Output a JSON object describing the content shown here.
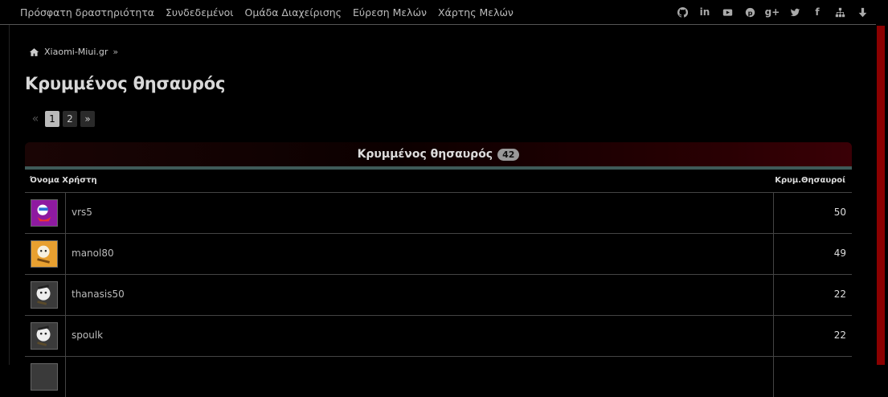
{
  "nav": {
    "links": [
      "Πρόσφατη δραστηριότητα",
      "Συνδεδεμένοι",
      "Ομάδα Διαχείρισης",
      "Εύρεση Μελών",
      "Χάρτης Μελών"
    ],
    "social_icons": [
      "github-icon",
      "linkedin-icon",
      "youtube-icon",
      "pinterest-icon",
      "google-plus-icon",
      "twitter-icon",
      "facebook-icon",
      "sitemap-icon",
      "arrow-down-icon"
    ]
  },
  "breadcrumb": {
    "home": "Xiaomi-Miui.gr",
    "separator": "»"
  },
  "page": {
    "title": "Κρυμμένος θησαυρός"
  },
  "pager": {
    "prev": "«",
    "pages": [
      "1",
      "2"
    ],
    "active": "1",
    "next": "»"
  },
  "block": {
    "title": "Κρυμμένος θησαυρός",
    "count": "42"
  },
  "table": {
    "col_user": "Όνομα Χρήστη",
    "col_value": "Κρυμ.Θησαυροί",
    "rows": [
      {
        "name": "vrs5",
        "value": "50",
        "avatar_color": "#8e1aa0"
      },
      {
        "name": "manol80",
        "value": "49",
        "avatar_color": "#e8a030"
      },
      {
        "name": "thanasis50",
        "value": "22",
        "avatar_color": "#3a3a3a"
      },
      {
        "name": "spoulk",
        "value": "22",
        "avatar_color": "#3a3a3a"
      }
    ]
  },
  "colors": {
    "accent_red": "#8b0000",
    "teal": "#3f5a58"
  }
}
